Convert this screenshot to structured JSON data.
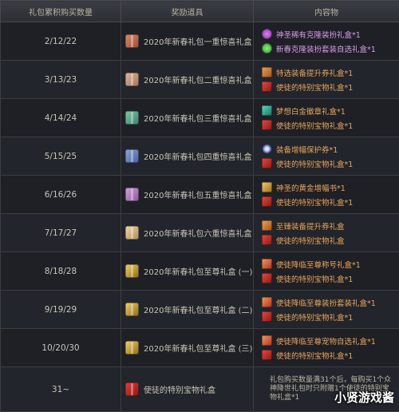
{
  "headers": {
    "col1": "礼包累积购买数量",
    "col2": "奖励道具",
    "col3": "内容物"
  },
  "rows": [
    {
      "count": "2/12/22",
      "reward": "2020年新春礼包一重惊喜礼盒",
      "items": [
        {
          "icon": "purple-orb-icon",
          "text": "神圣稀有克隆装扮礼盒*1"
        },
        {
          "icon": "green-orb-icon",
          "text": "新春克隆装扮套装自选礼盒*1"
        }
      ]
    },
    {
      "count": "3/13/23",
      "reward": "2020年新春礼包二重惊喜礼盒",
      "items": [
        {
          "icon": "orange-box-icon",
          "text": "特选装备提升券礼盒*1"
        },
        {
          "icon": "red-box-icon",
          "text": "使徒的特别宝物礼盒*1"
        }
      ]
    },
    {
      "count": "4/14/24",
      "reward": "2020年新春礼包三重惊喜礼盒",
      "items": [
        {
          "icon": "teal-sword-icon",
          "text": "梦想白金徽章礼盒*1"
        },
        {
          "icon": "red-box-icon",
          "text": "使徒的特别宝物礼盒*1"
        }
      ]
    },
    {
      "count": "5/15/25",
      "reward": "2020年新春礼包四重惊喜礼盒",
      "items": [
        {
          "icon": "swirl-icon",
          "text": "装备增幅保护券*1"
        },
        {
          "icon": "red-box-icon",
          "text": "使徒的特别宝物礼盒*1"
        }
      ]
    },
    {
      "count": "6/16/26",
      "reward": "2020年新春礼包五重惊喜礼盒",
      "items": [
        {
          "icon": "gold-scroll-icon",
          "text": "神圣的黄金增幅书*1"
        },
        {
          "icon": "red-box-icon",
          "text": "使徒的特别宝物礼盒*1"
        }
      ]
    },
    {
      "count": "7/17/27",
      "reward": "2020年新春礼包六重惊喜礼盒",
      "items": [
        {
          "icon": "orange-box-icon",
          "text": "至臻装备提升券礼盒"
        },
        {
          "icon": "red-box-icon",
          "text": "使徒的特别宝物礼盒"
        }
      ]
    },
    {
      "count": "8/18/28",
      "reward": "2020年新春礼包至尊礼盒 (一)",
      "items": [
        {
          "icon": "gold-box-icon",
          "text": "使徒降临至尊称号礼盒*1"
        },
        {
          "icon": "red-box-icon",
          "text": "使徒的特别宝物礼盒*1"
        }
      ]
    },
    {
      "count": "9/19/29",
      "reward": "2020年新春礼包至尊礼盒 (二)",
      "items": [
        {
          "icon": "gold-box-icon",
          "text": "使徒降临至尊装扮套装礼盒*1"
        },
        {
          "icon": "red-box-icon",
          "text": "使徒的特别宝物礼盒*1"
        }
      ]
    },
    {
      "count": "10/20/30",
      "reward": "2020年新春礼包至尊礼盒 (三)",
      "items": [
        {
          "icon": "gold-box-icon",
          "text": "使徒降临至尊宠物自选礼盒*1"
        },
        {
          "icon": "red-box-icon",
          "text": "使徒的特别宝物礼盒*1"
        }
      ]
    }
  ],
  "last_row": {
    "count": "31~",
    "reward": "使徒的特别宝物礼盒",
    "note": "礼包购买数量满31个后，每购买1个众神降世礼包时只附赠1个使徒的特别宝物礼盒*1"
  },
  "watermark": "小贤游戏酱",
  "colors": {
    "background": "#15171c",
    "item_purple": "#d89ae8",
    "item_orange": "#e9a45c"
  }
}
